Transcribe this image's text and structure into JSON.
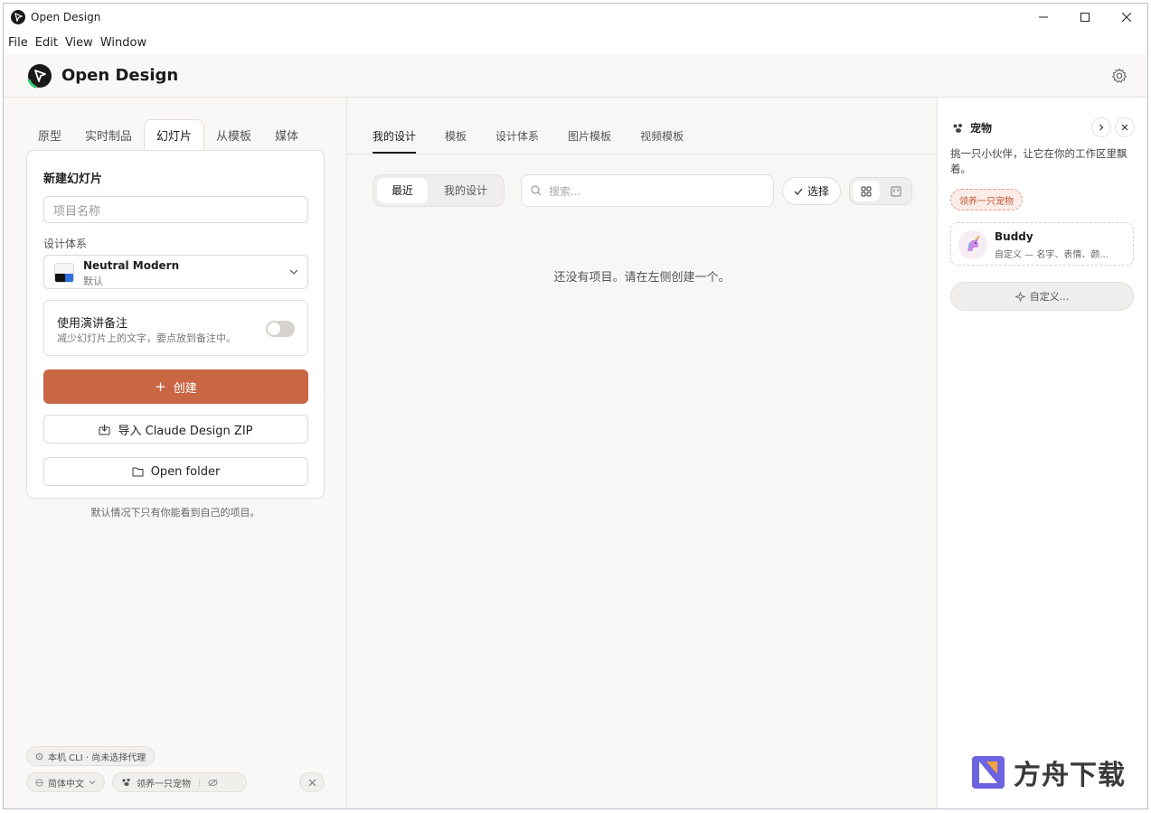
{
  "window": {
    "title": "Open Design"
  },
  "menu": [
    "File",
    "Edit",
    "View",
    "Window"
  ],
  "header": {
    "brand": "Open Design"
  },
  "left": {
    "tabs": [
      "原型",
      "实时制品",
      "幻灯片",
      "从模板",
      "媒体"
    ],
    "active_tab": "幻灯片",
    "card_title": "新建幻灯片",
    "name_placeholder": "项目名称",
    "design_system_label": "设计体系",
    "design_system_name": "Neutral Modern",
    "design_system_sub": "默认",
    "notes_title": "使用演讲备注",
    "notes_sub": "减少幻灯片上的文字，要点放到备注中。",
    "create_label": "创建",
    "import_label": "导入 Claude Design ZIP",
    "open_folder_label": "Open folder",
    "note": "默认情况下只有你能看到自己的项目。",
    "cli_pill": "本机 CLI · 尚未选择代理",
    "lang_pill": "简体中文",
    "adopt_pill": "领养一只宠物"
  },
  "center": {
    "tabs": [
      "我的设计",
      "模板",
      "设计体系",
      "图片模板",
      "视频模板"
    ],
    "seg": [
      "最近",
      "我的设计"
    ],
    "search_placeholder": "搜索...",
    "select_label": "选择",
    "empty_text": "还没有项目。请在左侧创建一个。"
  },
  "right": {
    "title": "宠物",
    "desc": "挑一只小伙伴，让它在你的工作区里飘着。",
    "adopt_badge": "领养一只宠物",
    "buddy_name": "Buddy",
    "buddy_sub": "自定义 — 名字、表情、颜...",
    "custom_label": "自定义...",
    "watermark": "方舟下载"
  },
  "colors": {
    "accent": "#c96644",
    "logo_bg": "#1a1a1a",
    "logo_fg": "#2ecc71"
  }
}
